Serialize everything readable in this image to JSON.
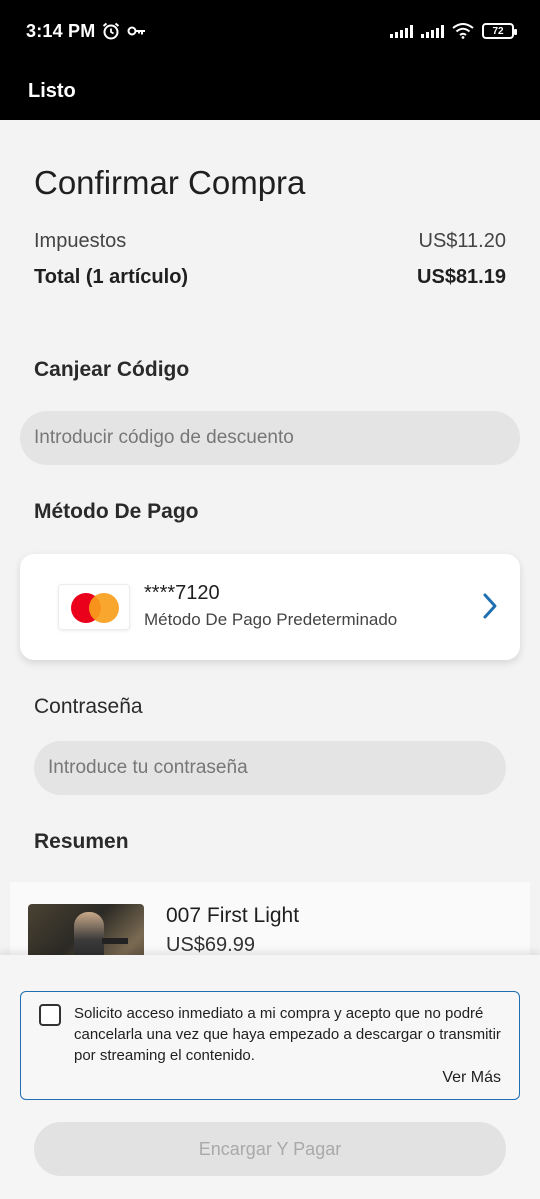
{
  "status_bar": {
    "time": "3:14 PM",
    "battery": "72"
  },
  "appbar": {
    "done_label": "Listo"
  },
  "page": {
    "title": "Confirmar Compra"
  },
  "totals": {
    "tax_label": "Impuestos",
    "tax_value": "US$11.20",
    "total_label": "Total (1 artículo)",
    "total_value": "US$81.19"
  },
  "redeem": {
    "heading": "Canjear Código",
    "placeholder": "Introducir código de descuento"
  },
  "payment": {
    "heading": "Método De Pago",
    "card_number": "****7120",
    "card_subtitle": "Método De Pago Predeterminado"
  },
  "password": {
    "heading": "Contraseña",
    "placeholder": "Introduce tu contraseña"
  },
  "summary": {
    "heading": "Resumen",
    "items": [
      {
        "title": "007 First Light",
        "price": "US$69.99"
      }
    ]
  },
  "consent": {
    "text": "Solicito acceso inmediato a mi compra y acepto que no podré cancelarla una vez que haya empezado a descargar o transmitir por streaming el contenido.",
    "see_more": "Ver Más"
  },
  "pay_button": {
    "label": "Encargar Y Pagar"
  },
  "colors": {
    "accent": "#1f6fb2",
    "mastercard_red": "#eb001b",
    "mastercard_orange": "#f79e1b"
  }
}
